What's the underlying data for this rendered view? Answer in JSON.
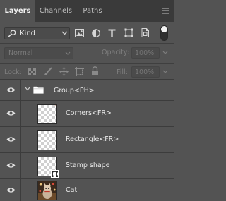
{
  "tabs": [
    {
      "label": "Layers",
      "active": true
    },
    {
      "label": "Channels",
      "active": false
    },
    {
      "label": "Paths",
      "active": false
    }
  ],
  "filter": {
    "kind_label": "Kind"
  },
  "blend_mode": "Normal",
  "opacity": {
    "label": "Opacity:",
    "value": "100%"
  },
  "lock": {
    "label": "Lock:"
  },
  "fill": {
    "label": "Fill:",
    "value": "100%"
  },
  "layers": [
    {
      "name": "Group<PH>",
      "type": "group",
      "visible": true,
      "expanded": true
    },
    {
      "name": "Corners<FR>",
      "type": "layer",
      "visible": true
    },
    {
      "name": "Rectangle<FR>",
      "type": "layer",
      "visible": true
    },
    {
      "name": "Stamp shape",
      "type": "shape",
      "visible": true
    },
    {
      "name": "Cat",
      "type": "image",
      "visible": true
    }
  ],
  "colors": {
    "panel_bg": "#535353",
    "tab_bar_bg": "#3a3a3a",
    "text": "#e8e8e8",
    "dim_text": "#7e7e7e"
  }
}
